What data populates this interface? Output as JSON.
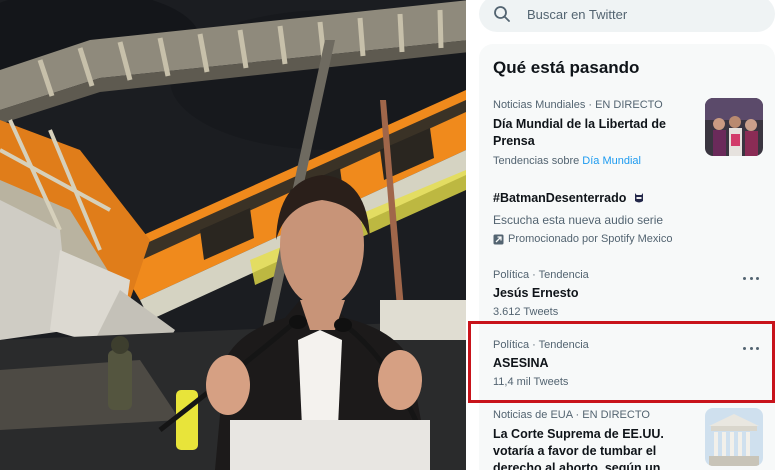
{
  "search": {
    "placeholder": "Buscar en Twitter",
    "icon": "search-icon"
  },
  "trends_panel": {
    "title": "Qué está pasando",
    "items": [
      {
        "meta": "Noticias Mundiales · EN DIRECTO",
        "name": "Día Mundial de la Libertad de Prensa",
        "sub_prefix": "Tendencias sobre",
        "sub_link": "Día Mundial"
      },
      {
        "name": "#BatmanDesenterrado",
        "name_icon": "batman-emoji-icon",
        "sub": "Escucha esta nueva audio serie",
        "promo": "Promocionado por Spotify Mexico",
        "promo_icon": "promoted-icon"
      },
      {
        "meta": "Política · Tendencia",
        "name": "Jesús Ernesto",
        "count": "3.612 Tweets"
      },
      {
        "meta": "Política · Tendencia",
        "name": "ASESINA",
        "count": "11,4 mil Tweets",
        "highlighted": true
      },
      {
        "meta": "Noticias de EUA · EN DIRECTO",
        "name": "La Corte Suprema de EE.UU. votaría a favor de tumbar el derecho al aborto, según un"
      }
    ]
  },
  "colors": {
    "highlight": "#c8131b",
    "link": "#1d9bf0",
    "metro_orange": "#f08a1c"
  }
}
